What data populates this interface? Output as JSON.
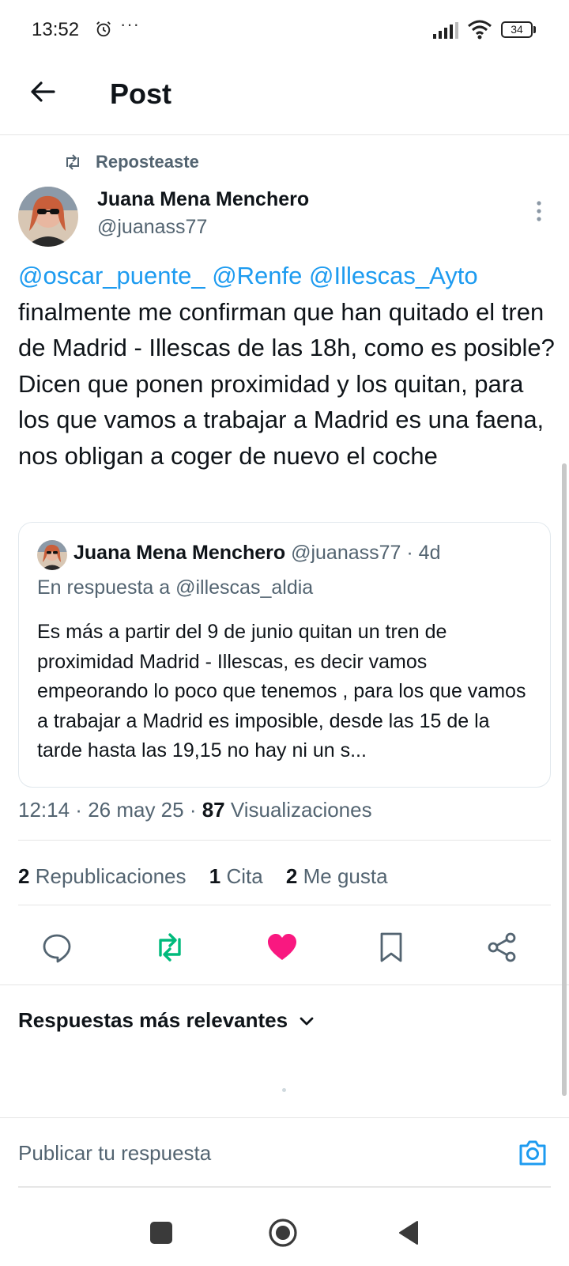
{
  "status_bar": {
    "time": "13:52",
    "more": "···",
    "battery": "34"
  },
  "header": {
    "title": "Post"
  },
  "repost": {
    "label": "Reposteaste"
  },
  "author": {
    "name": "Juana Mena Menchero",
    "handle": "@juanass77"
  },
  "tweet": {
    "mentions": [
      "@oscar_puente_",
      "@Renfe",
      "@Illescas_Ayto"
    ],
    "text": "finalmente me confirman que han quitado el tren de Madrid - Illescas de las 18h, como es posible? Dicen que ponen proximidad y los quitan, para los que vamos a trabajar a Madrid es una faena, nos obligan a coger de nuevo el coche"
  },
  "quote": {
    "name": "Juana Mena Menchero",
    "handle": "@juanass77",
    "separator": " · ",
    "age": "4d",
    "reply_to": "En respuesta a @illescas_aldia",
    "body": "Es más a partir del 9 de junio quitan un tren de proximidad Madrid - Illescas, es decir vamos empeorando lo poco que tenemos , para los que vamos a trabajar a Madrid es imposible, desde las 15 de la tarde hasta las 19,15 no hay ni un s..."
  },
  "meta": {
    "time": "12:14",
    "sep": " · ",
    "date": "26 may 25",
    "sep2": " · ",
    "views": "87",
    "views_label": "Visualizaciones"
  },
  "stats": {
    "reposts_count": "2",
    "reposts_label": "Republicaciones",
    "quotes_count": "1",
    "quotes_label": "Cita",
    "likes_count": "2",
    "likes_label": "Me gusta"
  },
  "actions": {
    "reply_icon": "reply-icon",
    "repost_icon": "repost-icon",
    "like_icon": "heart-icon",
    "bookmark_icon": "bookmark-icon",
    "share_icon": "share-icon"
  },
  "colors": {
    "accent": "#1d9bf0",
    "repost_active": "#00ba7c",
    "like_active": "#f91880",
    "muted": "#536471",
    "text": "#0f1419"
  },
  "replies": {
    "sort_label": "Respuestas más relevantes"
  },
  "composer": {
    "placeholder": "Publicar tu respuesta"
  }
}
